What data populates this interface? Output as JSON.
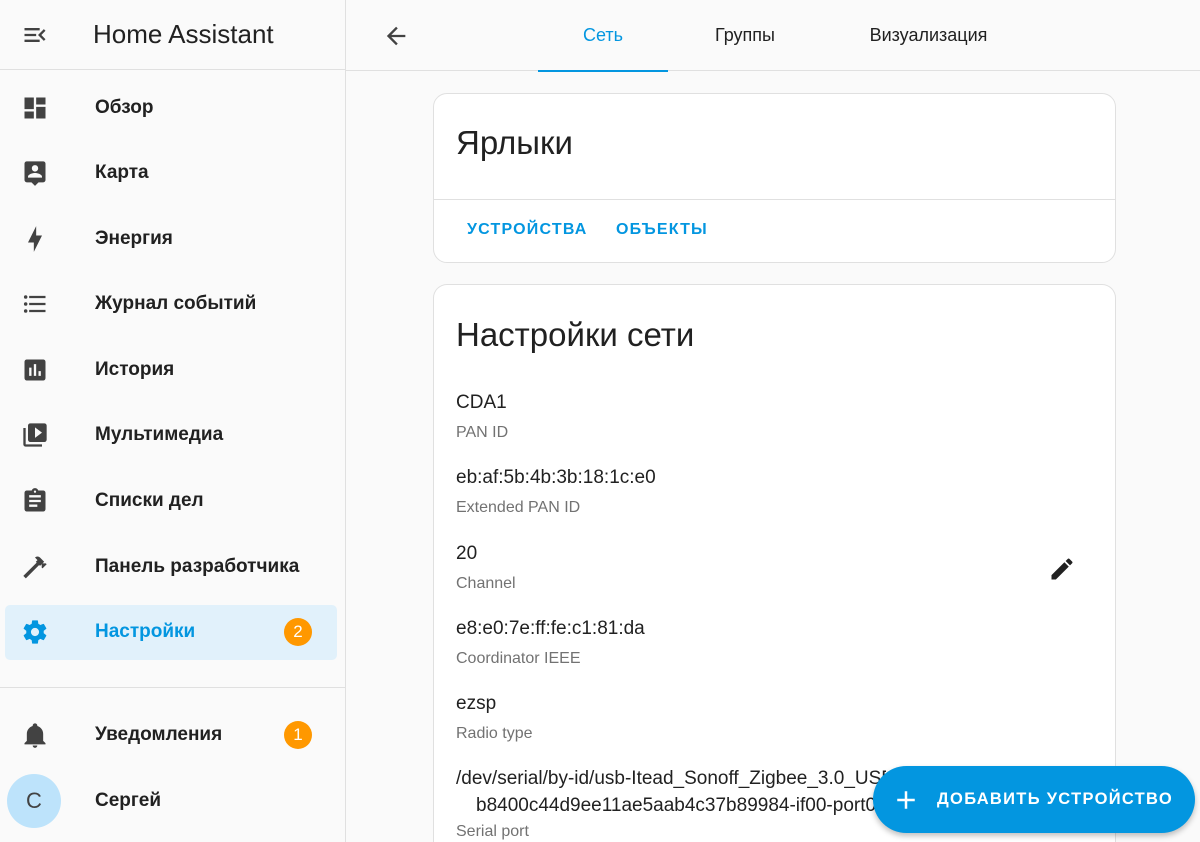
{
  "app": {
    "title": "Home Assistant"
  },
  "sidebar": {
    "items": [
      {
        "label": "Обзор",
        "icon": "dashboard-icon"
      },
      {
        "label": "Карта",
        "icon": "map-account-icon"
      },
      {
        "label": "Энергия",
        "icon": "lightning-bolt-icon"
      },
      {
        "label": "Журнал событий",
        "icon": "format-list-bulleted-icon"
      },
      {
        "label": "История",
        "icon": "chart-box-icon"
      },
      {
        "label": "Мультимедиа",
        "icon": "play-box-multiple-icon"
      },
      {
        "label": "Списки дел",
        "icon": "clipboard-list-icon"
      },
      {
        "label": "Панель разработчика",
        "icon": "hammer-icon"
      },
      {
        "label": "Настройки",
        "icon": "cog-icon",
        "badge": "2",
        "active": true
      }
    ],
    "notifications": {
      "label": "Уведомления",
      "badge": "1",
      "icon": "bell-icon"
    },
    "user": {
      "name": "Сергей",
      "initial": "С"
    }
  },
  "tabs": [
    {
      "label": "Сеть",
      "active": true
    },
    {
      "label": "Группы"
    },
    {
      "label": "Визуализация"
    }
  ],
  "shortcuts": {
    "title": "Ярлыки",
    "devices_label": "УСТРОЙСТВА",
    "entities_label": "ОБЪЕКТЫ"
  },
  "network": {
    "title": "Настройки сети",
    "fields": [
      {
        "value": "CDA1",
        "label": "PAN ID"
      },
      {
        "value": "eb:af:5b:4b:3b:18:1c:e0",
        "label": "Extended PAN ID"
      },
      {
        "value": "20",
        "label": "Channel"
      },
      {
        "value": "e8:e0:7e:ff:fe:c1:81:da",
        "label": "Coordinator IEEE"
      },
      {
        "value": "ezsp",
        "label": "Radio type"
      }
    ],
    "serial_port": {
      "line1": "/dev/serial/by-id/usb-Itead_Sonoff_Zigbee_3.0_USB_Dongle_Plus_V2_",
      "line2": "b8400c44d9ee11ae5aab4c37b89984-if00-port0",
      "label": "Serial port"
    }
  },
  "fab": {
    "label": "ДОБАВИТЬ УСТРОЙСТВО"
  },
  "colors": {
    "accent": "#0396e0",
    "badge": "#ff9800",
    "active_bg": "#e1f1fb"
  }
}
